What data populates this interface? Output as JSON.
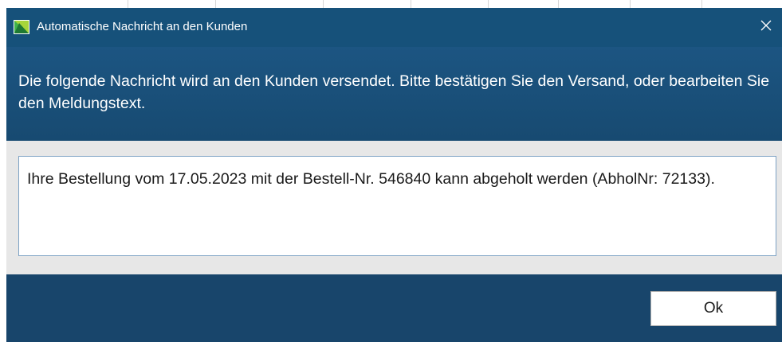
{
  "window": {
    "title": "Automatische Nachricht an den Kunden",
    "app_icon": "app-logo-icon",
    "close_icon": "close-icon",
    "close_glyph": "✕"
  },
  "header": {
    "text": "Die folgende Nachricht wird an den Kunden versendet. Bitte bestätigen Sie den Versand, oder bearbeiten Sie den Meldungstext."
  },
  "message": {
    "value": "Ihre Bestellung vom 17.05.2023 mit der Bestell-Nr. 546840 kann abgeholt werden (AbholNr: 72133)."
  },
  "footer": {
    "ok_label": "Ok"
  },
  "colors": {
    "titlebar": "#16517a",
    "header": "#1c5582",
    "content": "#e7e7e7",
    "footer": "#18456b",
    "icon_green": "#3fb24a"
  }
}
